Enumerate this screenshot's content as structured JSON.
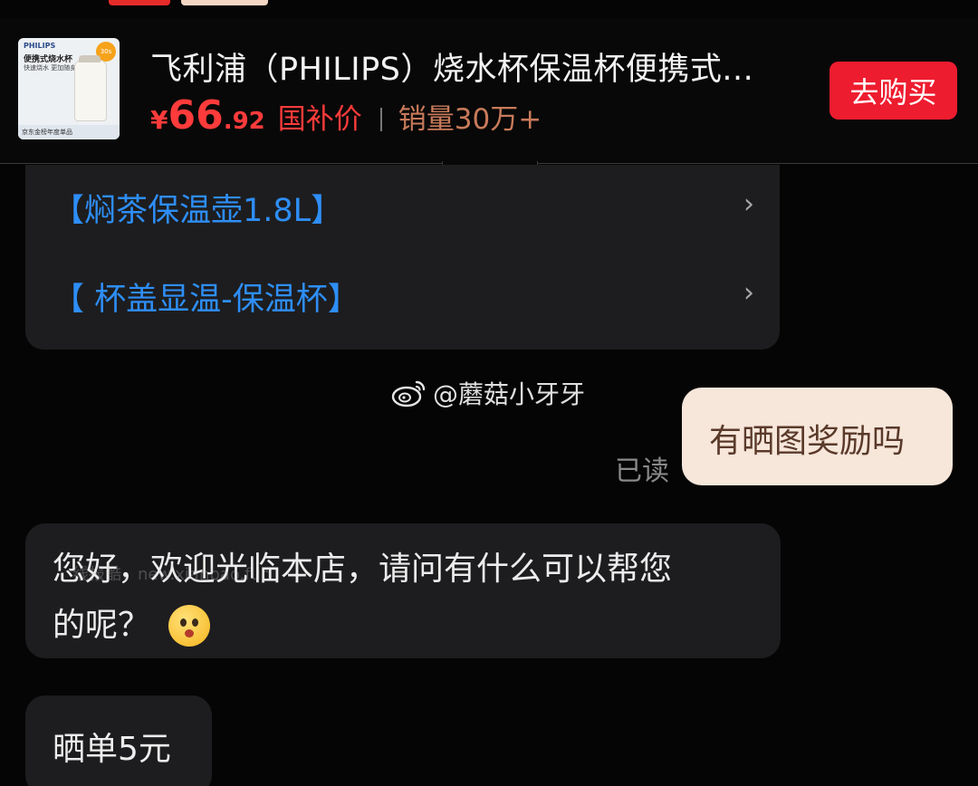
{
  "product": {
    "title": "飞利浦（PHILIPS）烧水杯保温杯便携式...",
    "price_symbol": "¥",
    "price_integer": "66",
    "price_decimal": ".92",
    "subsidy_label": "国补价",
    "sales": "销量30万+",
    "buy_button": "去购买",
    "thumbnail": {
      "brand": "PHILIPS",
      "headline": "便携式烧水杯",
      "subline": "快速烧水 更加随身",
      "badge": "30s",
      "footer": "京东金榜年度单品"
    }
  },
  "menu": {
    "items": [
      {
        "label": "【焖茶保温壶1.8L】",
        "chevron": "›"
      },
      {
        "label": "【 杯盖显温-保温杯】",
        "chevron": "›"
      }
    ]
  },
  "watermark": {
    "icon": "weibo-icon",
    "text": "@蘑菇小牙牙",
    "faint_text": "线报酷，new.xianbao.fun"
  },
  "chat": {
    "user_message": "有晒图奖励吗",
    "read_status": "已读",
    "agent_message_line1": "您好，欢迎光临本店，请问有什么可以帮您",
    "agent_message_line2": "的呢？",
    "agent_message_2": "晒单5元"
  },
  "colors": {
    "accent_red": "#ee1c2f",
    "link_blue": "#2e8ef7",
    "user_bubble": "#f7e6da",
    "agent_bubble": "#1d1d1f"
  }
}
